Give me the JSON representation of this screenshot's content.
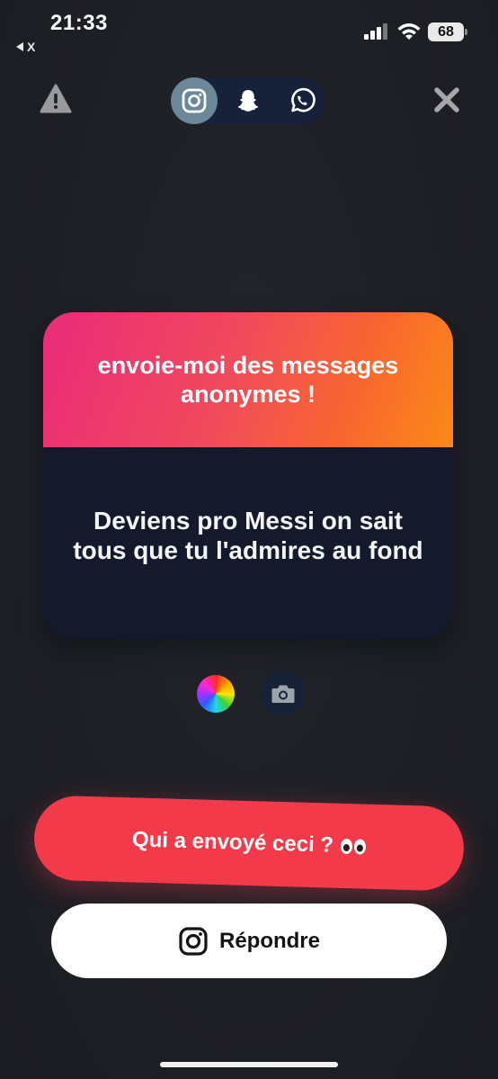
{
  "status_bar": {
    "time": "21:33",
    "back_app": "X",
    "battery": "68"
  },
  "toolbar": {
    "share_targets": [
      "instagram",
      "snapchat",
      "whatsapp"
    ],
    "active_target": "instagram"
  },
  "card": {
    "header": "envoie-moi des messages anonymes !",
    "message": "Deviens pro Messi on sait tous que tu l'admires au fond",
    "header_gradient": [
      "#ea2b7a",
      "#fb8a17"
    ]
  },
  "actions": {
    "who_sent": "Qui a envoyé ceci ?",
    "who_sent_emoji": "eyes",
    "reply": "Répondre"
  },
  "colors": {
    "accent_red": "#f23a4b",
    "card_body": "#141a2b",
    "background": "#1f2026"
  }
}
